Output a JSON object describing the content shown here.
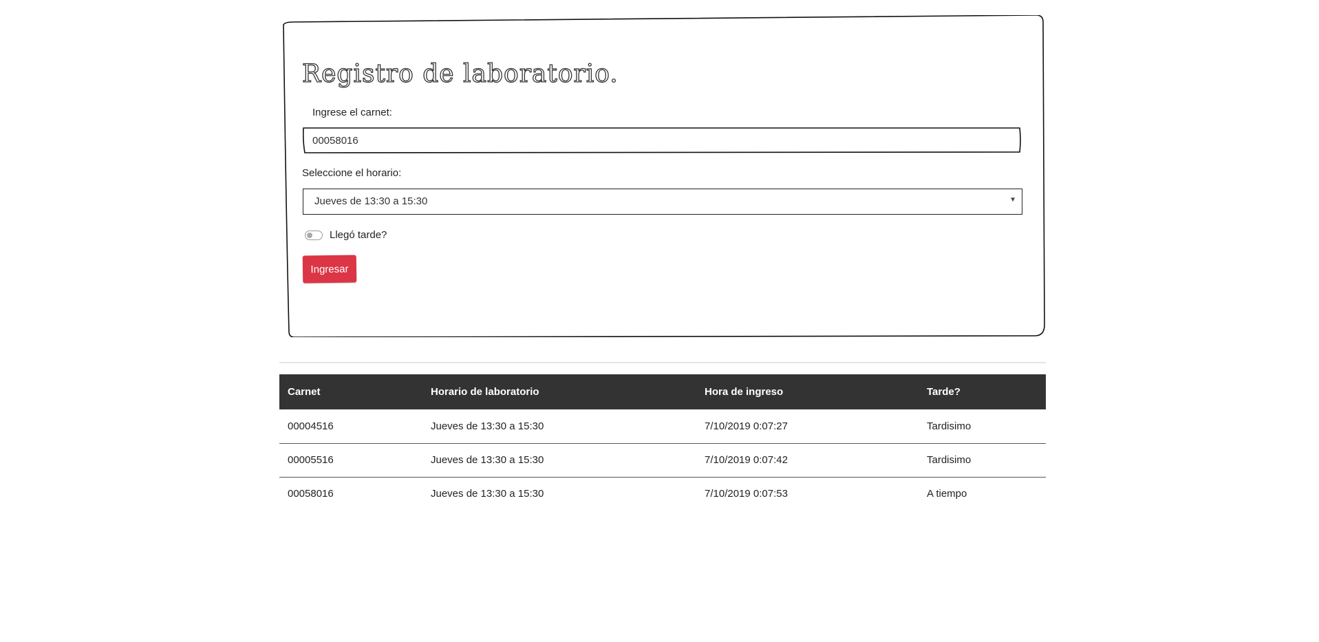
{
  "form": {
    "title": "Registro de laboratorio.",
    "carnet_label": "Ingrese el carnet:",
    "carnet_value": "00058016",
    "horario_label": "Seleccione el horario:",
    "horario_selected": "Jueves de 13:30 a 15:30",
    "late_label": "Llegó tarde?",
    "late_checked": false,
    "submit_label": "Ingresar",
    "submit_color": "#dc3545"
  },
  "table": {
    "headers": [
      "Carnet",
      "Horario de laboratorio",
      "Hora de ingreso",
      "Tarde?"
    ],
    "header_bg": "#333333",
    "rows": [
      [
        "00004516",
        "Jueves de 13:30 a 15:30",
        "7/10/2019 0:07:27",
        "Tardisimo"
      ],
      [
        "00005516",
        "Jueves de 13:30 a 15:30",
        "7/10/2019 0:07:42",
        "Tardisimo"
      ],
      [
        "00058016",
        "Jueves de 13:30 a 15:30",
        "7/10/2019 0:07:53",
        "A tiempo"
      ]
    ]
  }
}
